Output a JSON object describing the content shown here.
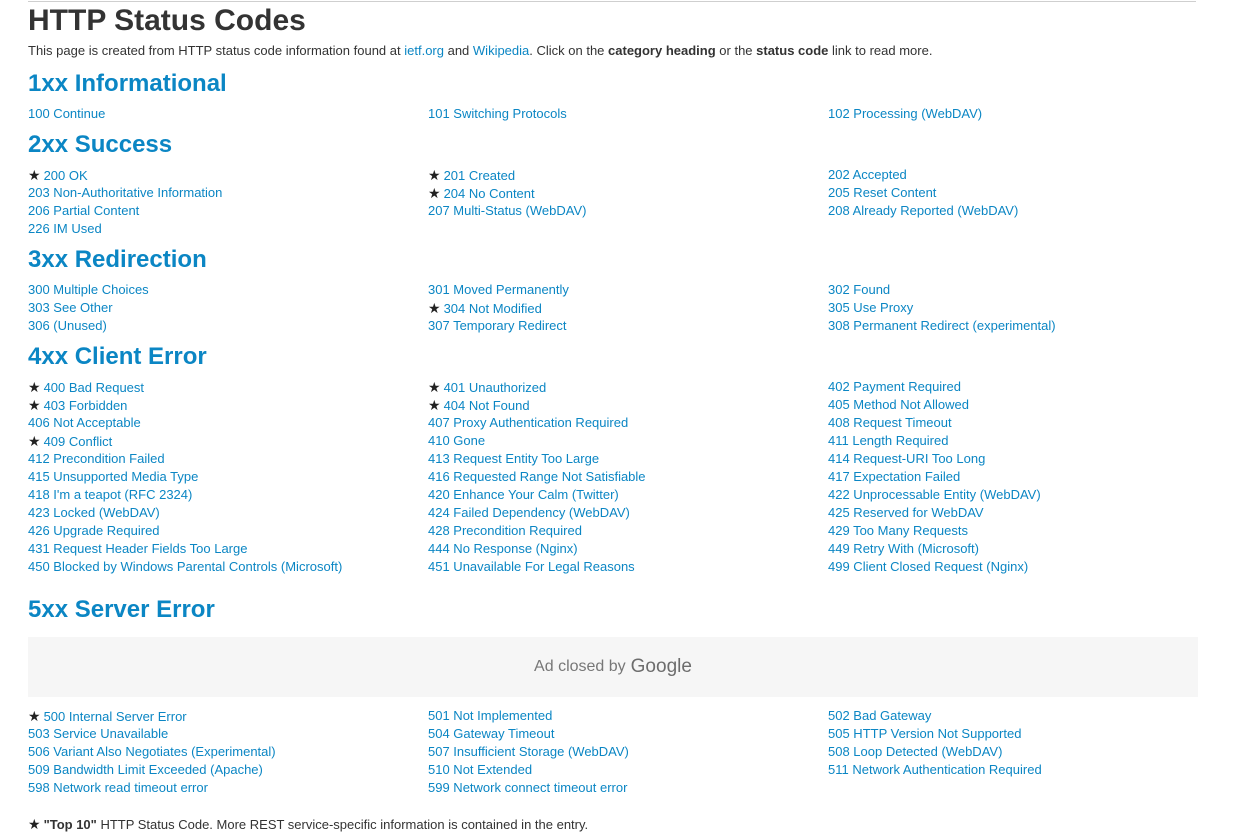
{
  "page": {
    "title": "HTTP Status Codes",
    "intro": {
      "t1": "This page is created from HTTP status code information found at ",
      "link1": "ietf.org",
      "t2": " and ",
      "link2": "Wikipedia",
      "t3": ". Click on the ",
      "b1": "category heading",
      "t4": " or the ",
      "b2": "status code",
      "t5": " link to read more."
    }
  },
  "star_glyph": "★",
  "categories": [
    {
      "heading": "1xx Informational",
      "codes": [
        {
          "label": "100 Continue",
          "top10": false
        },
        {
          "label": "101 Switching Protocols",
          "top10": false
        },
        {
          "label": "102 Processing (WebDAV)",
          "top10": false
        }
      ]
    },
    {
      "heading": "2xx Success",
      "codes": [
        {
          "label": "200 OK",
          "top10": true
        },
        {
          "label": "201 Created",
          "top10": true
        },
        {
          "label": "202 Accepted",
          "top10": false
        },
        {
          "label": "203 Non-Authoritative Information",
          "top10": false
        },
        {
          "label": "204 No Content",
          "top10": true
        },
        {
          "label": "205 Reset Content",
          "top10": false
        },
        {
          "label": "206 Partial Content",
          "top10": false
        },
        {
          "label": "207 Multi-Status (WebDAV)",
          "top10": false
        },
        {
          "label": "208 Already Reported (WebDAV)",
          "top10": false
        },
        {
          "label": "226 IM Used",
          "top10": false
        }
      ]
    },
    {
      "heading": "3xx Redirection",
      "codes": [
        {
          "label": "300 Multiple Choices",
          "top10": false
        },
        {
          "label": "301 Moved Permanently",
          "top10": false
        },
        {
          "label": "302 Found",
          "top10": false
        },
        {
          "label": "303 See Other",
          "top10": false
        },
        {
          "label": "304 Not Modified",
          "top10": true
        },
        {
          "label": "305 Use Proxy",
          "top10": false
        },
        {
          "label": "306 (Unused)",
          "top10": false
        },
        {
          "label": "307 Temporary Redirect",
          "top10": false
        },
        {
          "label": "308 Permanent Redirect (experimental)",
          "top10": false
        }
      ]
    },
    {
      "heading": "4xx Client Error",
      "codes": [
        {
          "label": "400 Bad Request",
          "top10": true
        },
        {
          "label": "401 Unauthorized",
          "top10": true
        },
        {
          "label": "402 Payment Required",
          "top10": false
        },
        {
          "label": "403 Forbidden",
          "top10": true
        },
        {
          "label": "404 Not Found",
          "top10": true
        },
        {
          "label": "405 Method Not Allowed",
          "top10": false
        },
        {
          "label": "406 Not Acceptable",
          "top10": false
        },
        {
          "label": "407 Proxy Authentication Required",
          "top10": false
        },
        {
          "label": "408 Request Timeout",
          "top10": false
        },
        {
          "label": "409 Conflict",
          "top10": true
        },
        {
          "label": "410 Gone",
          "top10": false
        },
        {
          "label": "411 Length Required",
          "top10": false
        },
        {
          "label": "412 Precondition Failed",
          "top10": false
        },
        {
          "label": "413 Request Entity Too Large",
          "top10": false
        },
        {
          "label": "414 Request-URI Too Long",
          "top10": false
        },
        {
          "label": "415 Unsupported Media Type",
          "top10": false
        },
        {
          "label": "416 Requested Range Not Satisfiable",
          "top10": false
        },
        {
          "label": "417 Expectation Failed",
          "top10": false
        },
        {
          "label": "418 I'm a teapot (RFC 2324)",
          "top10": false
        },
        {
          "label": "420 Enhance Your Calm (Twitter)",
          "top10": false
        },
        {
          "label": "422 Unprocessable Entity (WebDAV)",
          "top10": false
        },
        {
          "label": "423 Locked (WebDAV)",
          "top10": false
        },
        {
          "label": "424 Failed Dependency (WebDAV)",
          "top10": false
        },
        {
          "label": "425 Reserved for WebDAV",
          "top10": false
        },
        {
          "label": "426 Upgrade Required",
          "top10": false
        },
        {
          "label": "428 Precondition Required",
          "top10": false
        },
        {
          "label": "429 Too Many Requests",
          "top10": false
        },
        {
          "label": "431 Request Header Fields Too Large",
          "top10": false
        },
        {
          "label": "444 No Response (Nginx)",
          "top10": false
        },
        {
          "label": "449 Retry With (Microsoft)",
          "top10": false
        },
        {
          "label": "450 Blocked by Windows Parental Controls (Microsoft)",
          "top10": false
        },
        {
          "label": "451 Unavailable For Legal Reasons",
          "top10": false
        },
        {
          "label": "499 Client Closed Request (Nginx)",
          "top10": false
        }
      ]
    },
    {
      "heading": "5xx Server Error",
      "codes": [
        {
          "label": "500 Internal Server Error",
          "top10": true
        },
        {
          "label": "501 Not Implemented",
          "top10": false
        },
        {
          "label": "502 Bad Gateway",
          "top10": false
        },
        {
          "label": "503 Service Unavailable",
          "top10": false
        },
        {
          "label": "504 Gateway Timeout",
          "top10": false
        },
        {
          "label": "505 HTTP Version Not Supported",
          "top10": false
        },
        {
          "label": "506 Variant Also Negotiates (Experimental)",
          "top10": false
        },
        {
          "label": "507 Insufficient Storage (WebDAV)",
          "top10": false
        },
        {
          "label": "508 Loop Detected (WebDAV)",
          "top10": false
        },
        {
          "label": "509 Bandwidth Limit Exceeded (Apache)",
          "top10": false
        },
        {
          "label": "510 Not Extended",
          "top10": false
        },
        {
          "label": "511 Network Authentication Required",
          "top10": false
        },
        {
          "label": "598 Network read timeout error",
          "top10": false
        },
        {
          "label": "599 Network connect timeout error",
          "top10": false
        }
      ]
    }
  ],
  "ad": {
    "text": "Ad closed by",
    "brand": "Google"
  },
  "footer": {
    "star": "★",
    "bold": "\"Top 10\"",
    "text": " HTTP Status Code. More REST service-specific information is contained in the entry."
  }
}
